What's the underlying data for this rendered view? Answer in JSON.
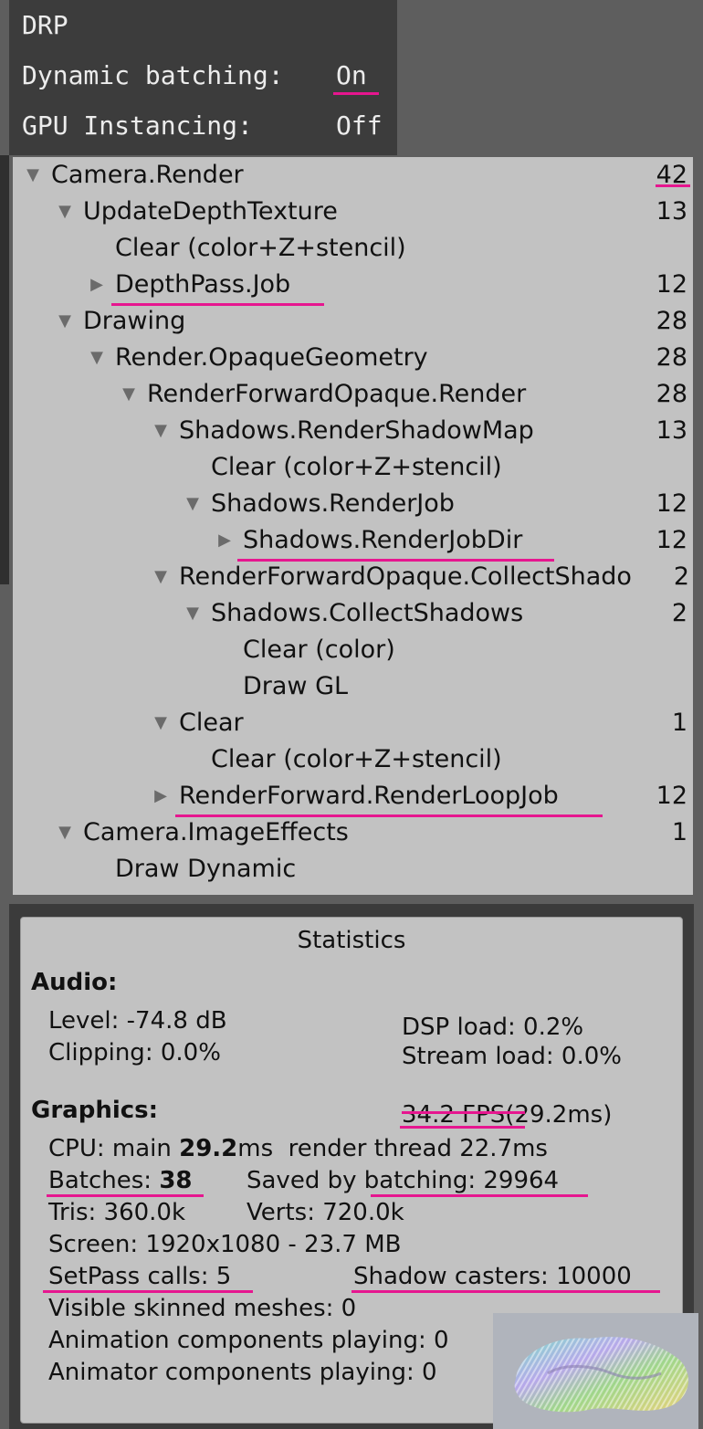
{
  "overlay": {
    "title": "DRP",
    "dynamic_batching_label": "Dynamic batching:",
    "dynamic_batching_value": "On",
    "gpu_instancing_label": "GPU Instancing:",
    "gpu_instancing_value": "Off"
  },
  "profiler_tree": [
    {
      "label": "Camera.Render",
      "count": "42",
      "expanded": true
    },
    {
      "label": "UpdateDepthTexture",
      "count": "13",
      "expanded": true
    },
    {
      "label": "Clear (color+Z+stencil)",
      "count": ""
    },
    {
      "label": "DepthPass.Job",
      "count": "12",
      "expanded": false
    },
    {
      "label": "Drawing",
      "count": "28",
      "expanded": true
    },
    {
      "label": "Render.OpaqueGeometry",
      "count": "28",
      "expanded": true
    },
    {
      "label": "RenderForwardOpaque.Render",
      "count": "28",
      "expanded": true
    },
    {
      "label": "Shadows.RenderShadowMap",
      "count": "13",
      "expanded": true
    },
    {
      "label": "Clear (color+Z+stencil)",
      "count": ""
    },
    {
      "label": "Shadows.RenderJob",
      "count": "12",
      "expanded": true
    },
    {
      "label": "Shadows.RenderJobDir",
      "count": "12",
      "expanded": false
    },
    {
      "label": "RenderForwardOpaque.CollectShado",
      "count": "2",
      "expanded": true
    },
    {
      "label": "Shadows.CollectShadows",
      "count": "2",
      "expanded": true
    },
    {
      "label": "Clear (color)",
      "count": ""
    },
    {
      "label": "Draw GL",
      "count": ""
    },
    {
      "label": "Clear",
      "count": "1",
      "expanded": true
    },
    {
      "label": "Clear (color+Z+stencil)",
      "count": ""
    },
    {
      "label": "RenderForward.RenderLoopJob",
      "count": "12",
      "expanded": false
    },
    {
      "label": "Camera.ImageEffects",
      "count": "1",
      "expanded": true
    },
    {
      "label": "Draw Dynamic",
      "count": ""
    }
  ],
  "statistics": {
    "title": "Statistics",
    "audio_heading": "Audio:",
    "level": "Level: -74.8 dB",
    "clipping": "Clipping: 0.0%",
    "dsp_load": "DSP load: 0.2%",
    "stream_load": "Stream load: 0.0%",
    "graphics_heading": "Graphics:",
    "fps": "34.2 FPS",
    "frame_ms": "(29.2ms)",
    "cpu_prefix": "CPU: main ",
    "cpu_main_ms": "29.2",
    "cpu_suffix": "ms  render thread 22.7ms",
    "batches_label": "Batches: ",
    "batches_value": "38",
    "saved_by_prefix": "Saved by ",
    "saved_by_batching": "batching: 29964",
    "tris": "Tris: 360.0k",
    "verts": "Verts: 720.0k",
    "screen": "Screen: 1920x1080 - 23.7 MB",
    "setpass": "SetPass calls: 5",
    "shadow_casters": "Shadow casters: 10000",
    "skinned": "Visible skinned meshes: 0",
    "animation": "Animation components playing: 0",
    "animator": "Animator components playing: 0"
  },
  "colors": {
    "highlight_underline": "#e6168f",
    "panel_background": "#c2c2c2",
    "overlay_background": "#3c3c3c"
  }
}
